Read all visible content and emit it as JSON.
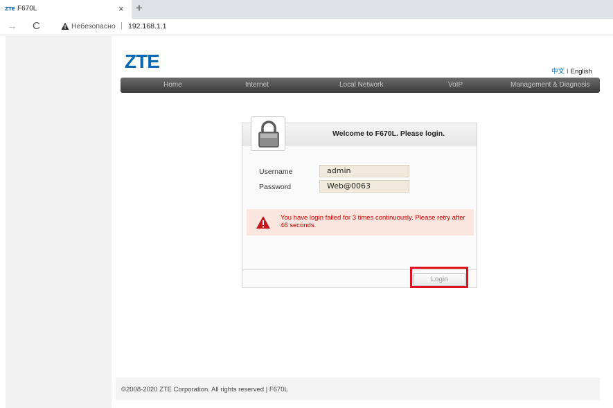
{
  "browser": {
    "tab": {
      "favicon": "ZTE",
      "title": "F670L",
      "close_glyph": "×"
    },
    "new_tab_glyph": "+",
    "nav": {
      "forward_glyph": "→",
      "reload_glyph": "C"
    },
    "address": {
      "security_label": "Небезопасно",
      "separator": "|",
      "url": "192.168.1.1"
    }
  },
  "header": {
    "logo": "ZTE",
    "lang": {
      "chinese": "中文",
      "separator": "I",
      "english": "English"
    }
  },
  "menu": {
    "items": [
      "Home",
      "Internet",
      "Local Network",
      "VoIP",
      "Management & Diagnosis"
    ]
  },
  "login": {
    "welcome": "Welcome to F670L. Please login.",
    "username_label": "Username",
    "username_value": "admin",
    "password_label": "Password",
    "password_value": "Web@0063",
    "error_message": "You have login failed for 3 times continuously. Please retry after 46 seconds.",
    "button_label": "Login"
  },
  "footer": {
    "copyright": "©2008-2020 ZTE Corporation. All rights reserved  |  F670L"
  },
  "colors": {
    "brand": "#0068b7",
    "error": "#c00000",
    "highlight": "#e01020"
  }
}
